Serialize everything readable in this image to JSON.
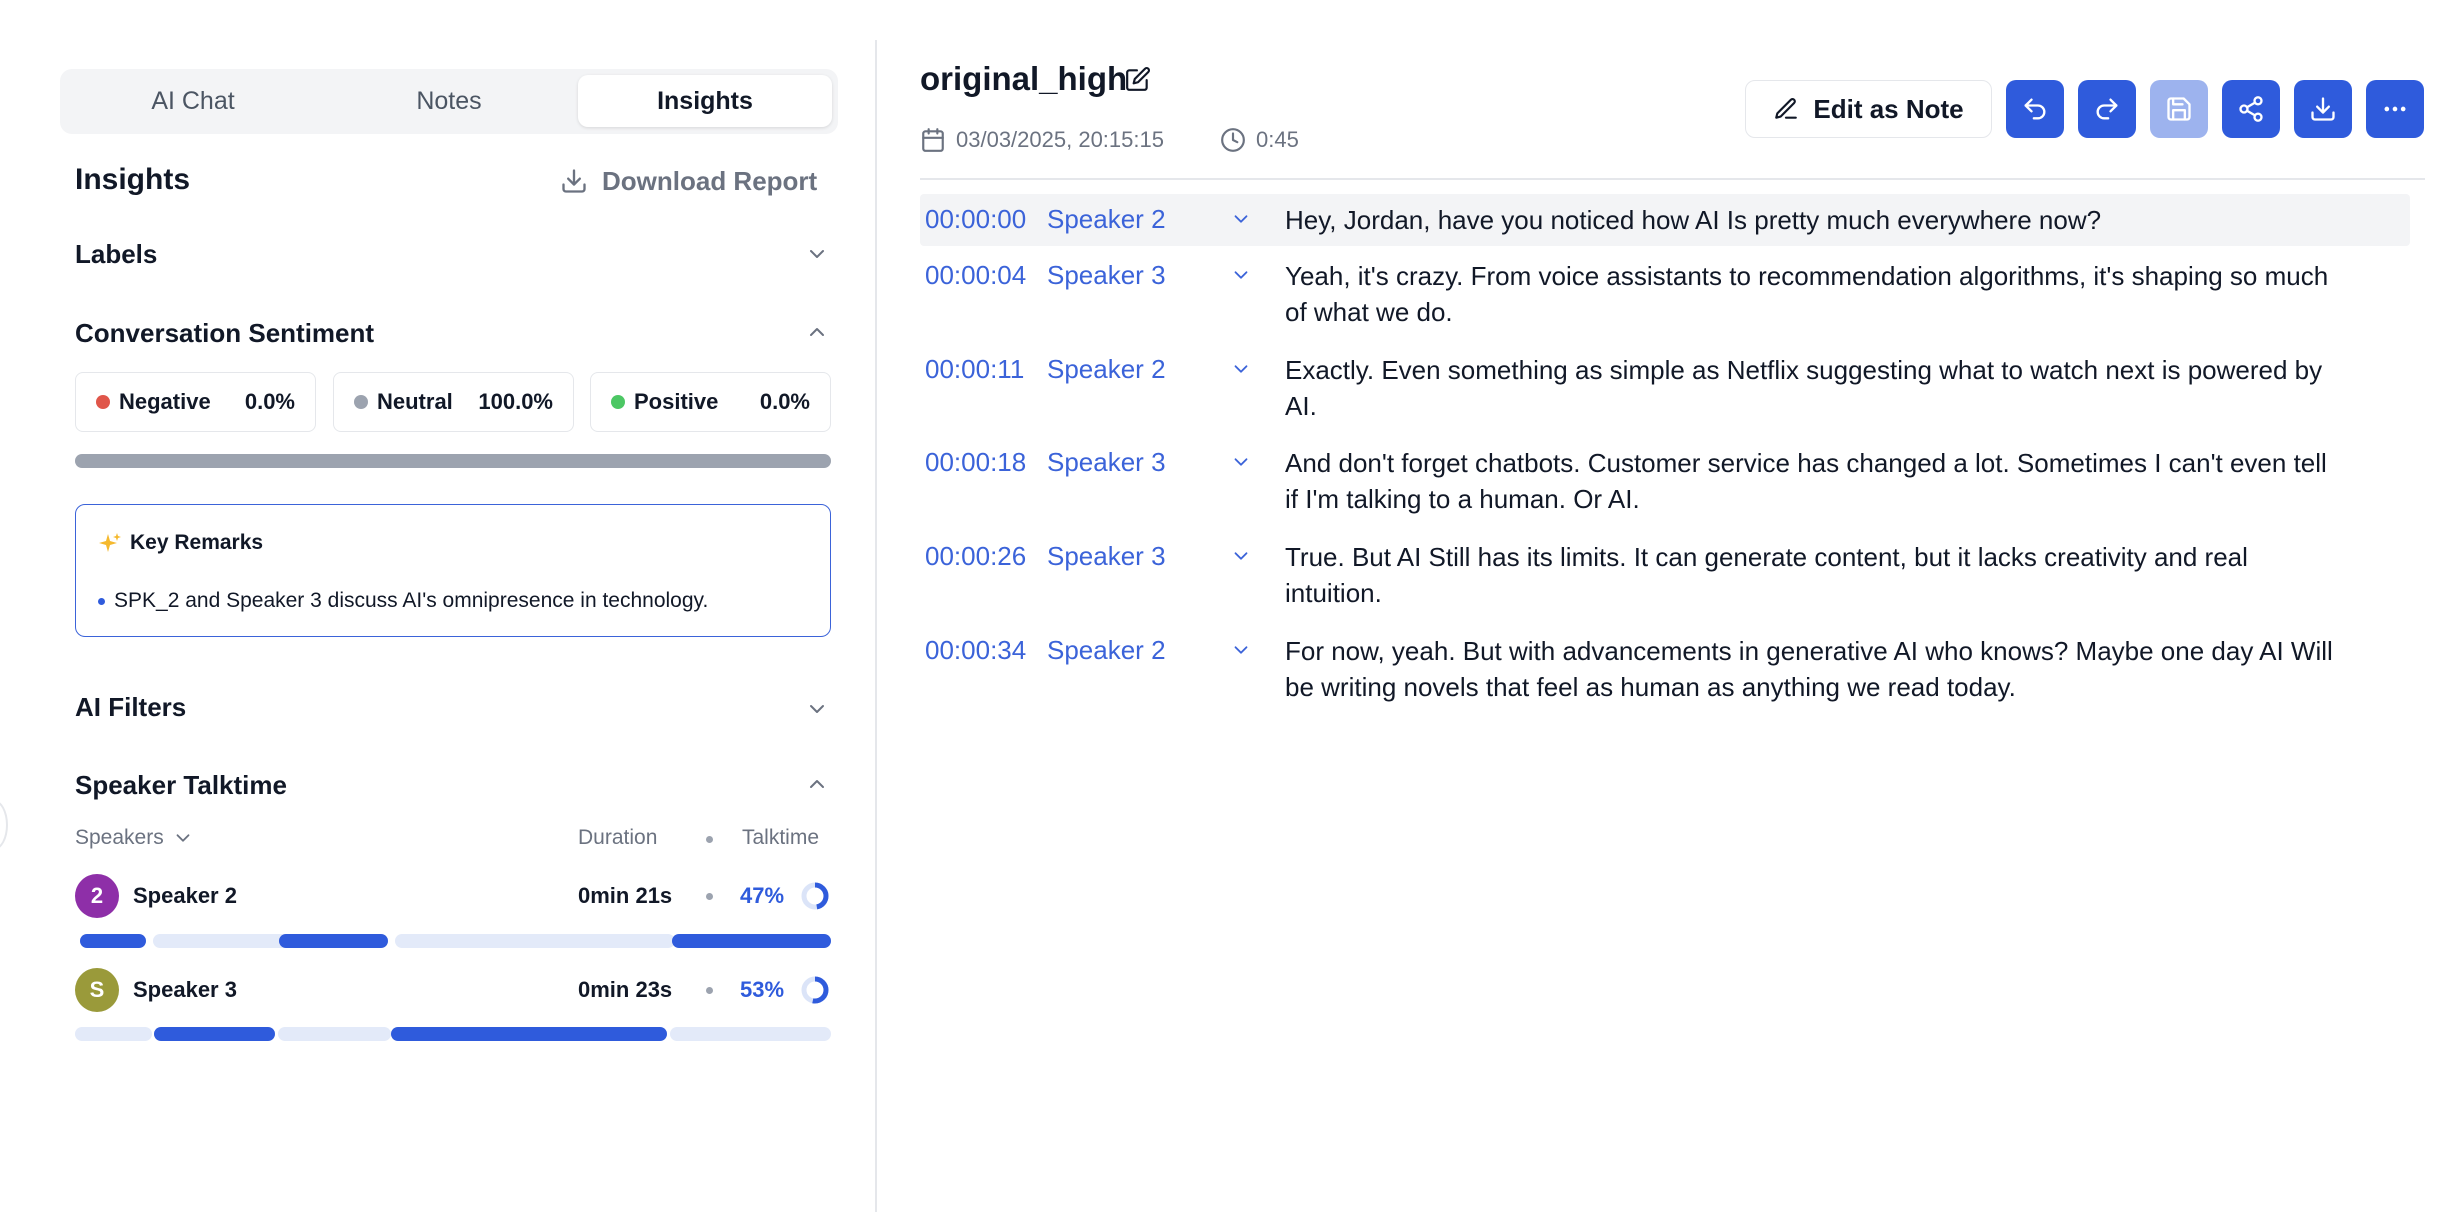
{
  "tabs": [
    {
      "label": "AI Chat",
      "active": false
    },
    {
      "label": "Notes",
      "active": false
    },
    {
      "label": "Insights",
      "active": true
    }
  ],
  "insights": {
    "title": "Insights",
    "download_report": "Download Report"
  },
  "sections": {
    "labels": "Labels",
    "sentiment": "Conversation Sentiment",
    "ai_filters": "AI Filters",
    "talktime": "Speaker Talktime"
  },
  "sentiment": [
    {
      "label": "Negative",
      "value": "0.0%",
      "color": "#e0564a"
    },
    {
      "label": "Neutral",
      "value": "100.0%",
      "color": "#9ca3af"
    },
    {
      "label": "Positive",
      "value": "0.0%",
      "color": "#4cc764"
    }
  ],
  "key_remarks": {
    "title": "Key Remarks",
    "items": [
      "SPK_2 and Speaker 3 discuss AI's omnipresence in technology."
    ]
  },
  "talktime": {
    "col_speakers": "Speakers",
    "col_duration": "Duration",
    "col_talktime": "Talktime",
    "speakers": [
      {
        "initial": "2",
        "name": "Speaker 2",
        "duration": "0min 21s",
        "percent": "47%",
        "fraction": 0.47,
        "color": "#8e2fa8"
      },
      {
        "initial": "S",
        "name": "Speaker 3",
        "duration": "0min 23s",
        "percent": "53%",
        "fraction": 0.53,
        "color": "#9a9a3a"
      }
    ]
  },
  "document": {
    "title": "original_high",
    "date": "03/03/2025, 20:15:15",
    "duration": "0:45",
    "edit_as_note": "Edit as Note"
  },
  "transcript": [
    {
      "time": "00:00:00",
      "speaker": "Speaker 2",
      "text": "Hey, Jordan, have you noticed how AI Is pretty much everywhere now?"
    },
    {
      "time": "00:00:04",
      "speaker": "Speaker 3",
      "text": "Yeah, it's crazy.  From voice assistants to recommendation algorithms, it's shaping so much of what we do."
    },
    {
      "time": "00:00:11",
      "speaker": "Speaker 2",
      "text": "Exactly.  Even something as simple as Netflix suggesting what to watch next is powered by AI."
    },
    {
      "time": "00:00:18",
      "speaker": "Speaker 3",
      "text": "And don't forget chatbots. Customer service has changed a lot. Sometimes I can't even tell if I'm talking to a human. Or AI."
    },
    {
      "time": "00:00:26",
      "speaker": "Speaker 3",
      "text": "True. But AI Still has its limits. It can generate content, but it lacks creativity and real intuition."
    },
    {
      "time": "00:00:34",
      "speaker": "Speaker 2",
      "text": "For now, yeah. But with advancements in generative AI who knows? Maybe one day AI Will be writing novels that feel as human as anything we read today."
    }
  ],
  "colors": {
    "accent": "#2f5bdc",
    "accent_disabled": "#9db3ee",
    "link": "#3b63d9",
    "segment_track": "#e3eaf9"
  }
}
